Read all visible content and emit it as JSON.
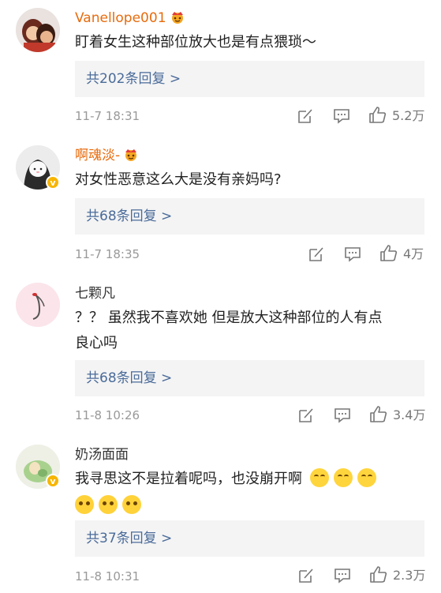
{
  "comments": [
    {
      "username": "Vanellope001",
      "text": "盯着女生这种部位放大也是有点猥琐～",
      "reply_label": "共202条回复 >",
      "time": "11-7 18:31",
      "likes": "5.2万"
    },
    {
      "username": "啊魂淡-",
      "text": "对女性恶意这么大是没有亲妈吗?",
      "reply_label": "共68条回复 >",
      "time": "11-7 18:35",
      "likes": "4万"
    },
    {
      "username": "七颗凡",
      "text_line1": "？？ 虽然我不喜欢她 但是放大这种部位的人有点",
      "text_line2": "良心吗",
      "reply_label": "共68条回复 >",
      "time": "11-8 10:26",
      "likes": "3.4万"
    },
    {
      "username": "奶汤面面",
      "text": "我寻思这不是拉着呢吗，也没崩开啊",
      "reply_label": "共37条回复 >",
      "time": "11-8 10:31",
      "likes": "2.3万"
    }
  ],
  "colors": {
    "vip_name": "#e86b0c",
    "reply_link": "#4a6b9a",
    "meta": "#999999",
    "reply_bg": "#f4f4f4",
    "badge": "#f7b500"
  },
  "icons": [
    "crown-icon",
    "verified-badge-icon",
    "repost-icon",
    "comment-icon",
    "like-icon",
    "smile-emoji-icon",
    "question-emoji-icon"
  ]
}
